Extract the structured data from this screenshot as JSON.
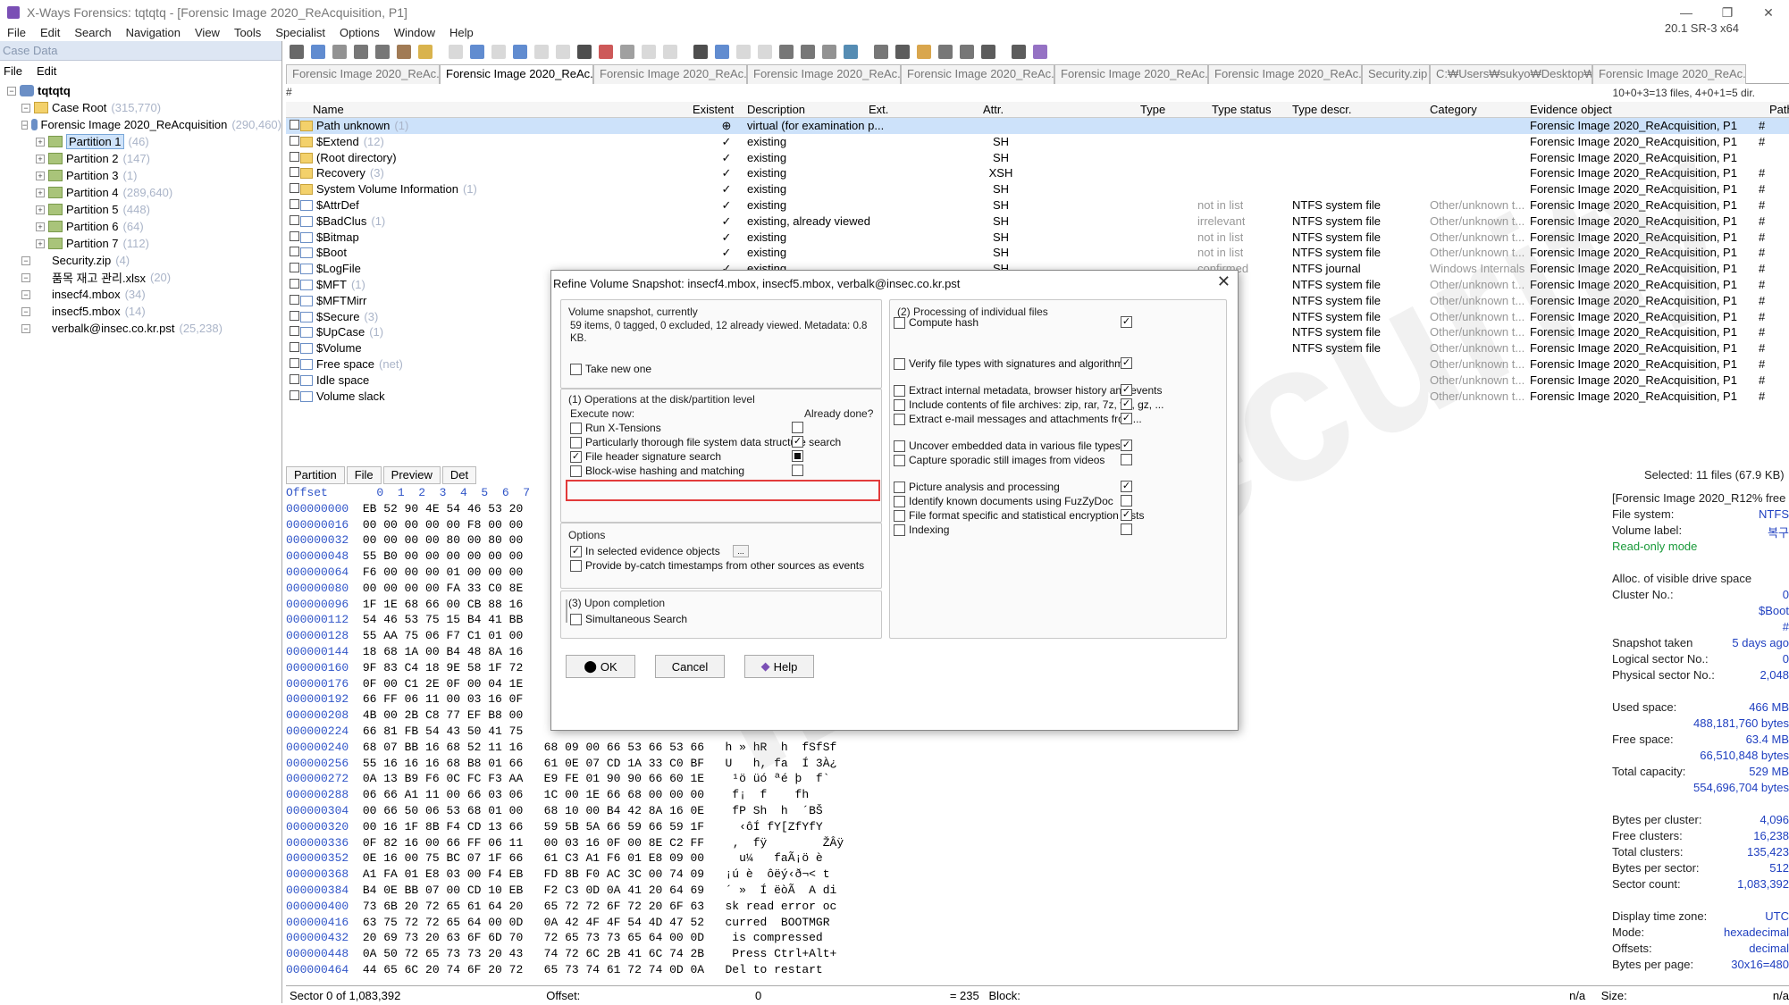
{
  "window": {
    "title": "X-Ways Forensics: tqtqtq - [Forensic Image 2020_ReAcquisition, P1]",
    "version": "20.1 SR-3 x64"
  },
  "menu": [
    "File",
    "Edit",
    "Search",
    "Navigation",
    "View",
    "Tools",
    "Specialist",
    "Options",
    "Window",
    "Help"
  ],
  "case": {
    "header": "Case Data",
    "menu": [
      "File",
      "Edit"
    ],
    "tree": [
      {
        "label": "tqtqtq",
        "count": "",
        "lvl": 0,
        "icon": "disk"
      },
      {
        "label": "Case Root",
        "count": "(315,770)",
        "lvl": 1,
        "icon": "fold"
      },
      {
        "label": "Forensic Image 2020_ReAcquisition",
        "count": "(290,460)",
        "lvl": 1,
        "icon": "disk"
      },
      {
        "label": "Partition 1",
        "count": "(46)",
        "lvl": 2,
        "icon": "part",
        "sel": true
      },
      {
        "label": "Partition 2",
        "count": "(147)",
        "lvl": 2,
        "icon": "part"
      },
      {
        "label": "Partition 3",
        "count": "(1)",
        "lvl": 2,
        "icon": "part"
      },
      {
        "label": "Partition 4",
        "count": "(289,640)",
        "lvl": 2,
        "icon": "part"
      },
      {
        "label": "Partition 5",
        "count": "(448)",
        "lvl": 2,
        "icon": "part"
      },
      {
        "label": "Partition 6",
        "count": "(64)",
        "lvl": 2,
        "icon": "part"
      },
      {
        "label": "Partition 7",
        "count": "(112)",
        "lvl": 2,
        "icon": "part"
      },
      {
        "label": "Security.zip",
        "count": "(4)",
        "lvl": 1,
        "icon": "file"
      },
      {
        "label": "품목 재고 관리.xlsx",
        "count": "(20)",
        "lvl": 1,
        "icon": "file"
      },
      {
        "label": "insecf4.mbox",
        "count": "(34)",
        "lvl": 1,
        "icon": "file"
      },
      {
        "label": "insecf5.mbox",
        "count": "(14)",
        "lvl": 1,
        "icon": "file"
      },
      {
        "label": "verbalk@insec.co.kr.pst",
        "count": "(25,238)",
        "lvl": 1,
        "icon": "file"
      }
    ]
  },
  "tabs": [
    "Forensic Image 2020_ReAc...",
    "Forensic Image 2020_ReAc...",
    "Forensic Image 2020_ReAc...",
    "Forensic Image 2020_ReAc...",
    "Forensic Image 2020_ReAc...",
    "Forensic Image 2020_ReAc...",
    "Forensic Image 2020_ReAc...",
    "Security.zip",
    "C:₩Users₩sukyo₩Desktop₩품...",
    "Forensic Image 2020_ReAc..."
  ],
  "count_text": "10+0+3=13 files, 4+0+1=5 dir.",
  "columns": [
    "Name",
    "Existent",
    "Description",
    "Ext.",
    "Attr.",
    "Type",
    "Type status",
    "Type descr.",
    "Category",
    "Evidence object",
    "Path"
  ],
  "rows": [
    {
      "name": "Path unknown",
      "count": "(1)",
      "ex": "⊕",
      "desc": "virtual (for examination p...",
      "attr": "",
      "ts": "",
      "td": "",
      "cat": "",
      "ev": "Forensic Image 2020_ReAcquisition, P1",
      "path": "#",
      "sel": true
    },
    {
      "name": "$Extend",
      "count": "(12)",
      "ex": "✓",
      "desc": "existing",
      "attr": "SH",
      "ts": "",
      "td": "",
      "cat": "",
      "ev": "Forensic Image 2020_ReAcquisition, P1",
      "path": "#"
    },
    {
      "name": "(Root directory)",
      "count": "",
      "ex": "✓",
      "desc": "existing",
      "attr": "SH",
      "ts": "",
      "td": "",
      "cat": "",
      "ev": "Forensic Image 2020_ReAcquisition, P1",
      "path": ""
    },
    {
      "name": "Recovery",
      "count": "(3)",
      "ex": "✓",
      "desc": "existing",
      "attr": "XSH",
      "ts": "",
      "td": "",
      "cat": "",
      "ev": "Forensic Image 2020_ReAcquisition, P1",
      "path": "#"
    },
    {
      "name": "System Volume Information",
      "count": "(1)",
      "ex": "✓",
      "desc": "existing",
      "attr": "SH",
      "ts": "",
      "td": "",
      "cat": "",
      "ev": "Forensic Image 2020_ReAcquisition, P1",
      "path": "#"
    },
    {
      "name": "$AttrDef",
      "count": "",
      "ex": "✓",
      "desc": "existing",
      "attr": "SH",
      "ts": "not in list",
      "td": "NTFS system file",
      "cat": "Other/unknown t...",
      "ev": "Forensic Image 2020_ReAcquisition, P1",
      "path": "#"
    },
    {
      "name": "$BadClus",
      "count": "(1)",
      "ex": "✓",
      "desc": "existing, already viewed",
      "attr": "SH",
      "ts": "irrelevant",
      "td": "NTFS system file",
      "cat": "Other/unknown t...",
      "ev": "Forensic Image 2020_ReAcquisition, P1",
      "path": "#"
    },
    {
      "name": "$Bitmap",
      "count": "",
      "ex": "✓",
      "desc": "existing",
      "attr": "SH",
      "ts": "not in list",
      "td": "NTFS system file",
      "cat": "Other/unknown t...",
      "ev": "Forensic Image 2020_ReAcquisition, P1",
      "path": "#"
    },
    {
      "name": "$Boot",
      "count": "",
      "ex": "✓",
      "desc": "existing",
      "attr": "SH",
      "ts": "not in list",
      "td": "NTFS system file",
      "cat": "Other/unknown t...",
      "ev": "Forensic Image 2020_ReAcquisition, P1",
      "path": "#"
    },
    {
      "name": "$LogFile",
      "count": "",
      "ex": "✓",
      "desc": "existing",
      "attr": "SH",
      "ts": "confirmed",
      "td": "NTFS journal",
      "cat": "Windows Internals",
      "ev": "Forensic Image 2020_ReAcquisition, P1",
      "path": "#"
    },
    {
      "name": "$MFT",
      "count": "(1)",
      "ex": "",
      "desc": "",
      "attr": "",
      "ts": "ed",
      "td": "NTFS system file",
      "cat": "Other/unknown t...",
      "ev": "Forensic Image 2020_ReAcquisition, P1",
      "path": "#"
    },
    {
      "name": "$MFTMirr",
      "count": "",
      "ex": "",
      "desc": "",
      "attr": "",
      "ts": "ed",
      "td": "NTFS system file",
      "cat": "Other/unknown t...",
      "ev": "Forensic Image 2020_ReAcquisition, P1",
      "path": "#"
    },
    {
      "name": "$Secure",
      "count": "(3)",
      "ex": "",
      "desc": "",
      "attr": "",
      "ts": "t",
      "td": "NTFS system file",
      "cat": "Other/unknown t...",
      "ev": "Forensic Image 2020_ReAcquisition, P1",
      "path": "#"
    },
    {
      "name": "$UpCase",
      "count": "(1)",
      "ex": "",
      "desc": "",
      "attr": "",
      "ts": "t",
      "td": "NTFS system file",
      "cat": "Other/unknown t...",
      "ev": "Forensic Image 2020_ReAcquisition, P1",
      "path": "#"
    },
    {
      "name": "$Volume",
      "count": "",
      "ex": "",
      "desc": "",
      "attr": "",
      "ts": "t",
      "td": "NTFS system file",
      "cat": "Other/unknown t...",
      "ev": "Forensic Image 2020_ReAcquisition, P1",
      "path": "#"
    },
    {
      "name": "Free space",
      "count": "(net)",
      "ex": "",
      "desc": "",
      "attr": "",
      "ts": "ied",
      "td": "",
      "cat": "Other/unknown t...",
      "ev": "Forensic Image 2020_ReAcquisition, P1",
      "path": "#"
    },
    {
      "name": "Idle space",
      "count": "",
      "ex": "",
      "desc": "",
      "attr": "",
      "ts": "ied",
      "td": "",
      "cat": "Other/unknown t...",
      "ev": "Forensic Image 2020_ReAcquisition, P1",
      "path": "#"
    },
    {
      "name": "Volume slack",
      "count": "",
      "ex": "",
      "desc": "",
      "attr": "",
      "ts": "ied",
      "td": "",
      "cat": "Other/unknown t...",
      "ev": "Forensic Image 2020_ReAcquisition, P1",
      "path": "#"
    }
  ],
  "midtabs": [
    "Partition",
    "File",
    "Preview",
    "Det"
  ],
  "selected_info": "Selected: 11 files (67.9 KB)",
  "hex": {
    "header": "Offset       0  1  2  3  4  5  6  7",
    "rows": [
      [
        "000000000",
        "EB 52 90 4E 54 46 53 20",
        ""
      ],
      [
        "000000016",
        "00 00 00 00 00 F8 00 00",
        ""
      ],
      [
        "000000032",
        "00 00 00 00 80 00 80 00",
        ""
      ],
      [
        "000000048",
        "55 B0 00 00 00 00 00 00",
        ""
      ],
      [
        "000000064",
        "F6 00 00 00 01 00 00 00",
        ""
      ],
      [
        "000000080",
        "00 00 00 00 FA 33 C0 8E",
        ""
      ],
      [
        "000000096",
        "1F 1E 68 66 00 CB 88 16",
        ""
      ],
      [
        "000000112",
        "54 46 53 75 15 B4 41 BB",
        ""
      ],
      [
        "000000128",
        "55 AA 75 06 F7 C1 01 00",
        ""
      ],
      [
        "000000144",
        "18 68 1A 00 B4 48 8A 16",
        ""
      ],
      [
        "000000160",
        "9F 83 C4 18 9E 58 1F 72",
        ""
      ],
      [
        "000000176",
        "0F 00 C1 2E 0F 00 04 1E",
        ""
      ],
      [
        "000000192",
        "66 FF 06 11 00 03 16 0F",
        ""
      ],
      [
        "000000208",
        "4B 00 2B C8 77 EF B8 00",
        ""
      ],
      [
        "000000224",
        "66 81 FB 54 43 50 41 75",
        ""
      ],
      [
        "000000240",
        "68 07 BB 16 68 52 11 16",
        "68 09 00 66 53 66 53 66   h » hR  h  fSfSf"
      ],
      [
        "000000256",
        "55 16 16 16 68 B8 01 66",
        "61 0E 07 CD 1A 33 C0 BF   U   h, fa  Í 3À¿"
      ],
      [
        "000000272",
        "0A 13 B9 F6 0C FC F3 AA",
        "E9 FE 01 90 90 66 60 1E    ¹ö üó ªé þ  f`"
      ],
      [
        "000000288",
        "06 66 A1 11 00 66 03 06",
        "1C 00 1E 66 68 00 00 00    f¡  f    fh"
      ],
      [
        "000000304",
        "00 66 50 06 53 68 01 00",
        "68 10 00 B4 42 8A 16 0E    fP Sh  h  ´BŠ"
      ],
      [
        "000000320",
        "00 16 1F 8B F4 CD 13 66",
        "59 5B 5A 66 59 66 59 1F     ‹ôÍ fY[ZfYfY"
      ],
      [
        "000000336",
        "0F 82 16 00 66 FF 06 11",
        "00 03 16 0F 00 8E C2 FF    ‚  fÿ        ŽÂÿ"
      ],
      [
        "000000352",
        "0E 16 00 75 BC 07 1F 66",
        "61 C3 A1 F6 01 E8 09 00     u¼   faÃ¡ö è"
      ],
      [
        "000000368",
        "A1 FA 01 E8 03 00 F4 EB",
        "FD 8B F0 AC 3C 00 74 09   ¡ú è  ôëý‹ð¬< t"
      ],
      [
        "000000384",
        "B4 0E BB 07 00 CD 10 EB",
        "F2 C3 0D 0A 41 20 64 69   ´ »  Í ëòÃ  A di"
      ],
      [
        "000000400",
        "73 6B 20 72 65 61 64 20",
        "65 72 72 6F 72 20 6F 63   sk read error oc"
      ],
      [
        "000000416",
        "63 75 72 72 65 64 00 0D",
        "0A 42 4F 4F 54 4D 47 52   curred  BOOTMGR"
      ],
      [
        "000000432",
        "20 69 73 20 63 6F 6D 70",
        "72 65 73 73 65 64 00 0D    is compressed"
      ],
      [
        "000000448",
        "0A 50 72 65 73 73 20 43",
        "74 72 6C 2B 41 6C 74 2B    Press Ctrl+Alt+"
      ],
      [
        "000000464",
        "44 65 6C 20 74 6F 20 72",
        "65 73 74 61 72 74 0D 0A   Del to restart"
      ]
    ]
  },
  "info": {
    "title": "[Forensic Image 2020_R12% free",
    "rows": [
      [
        "File system:",
        "NTFS"
      ],
      [
        "Volume label:",
        "복구"
      ],
      [
        "Read-only mode",
        ""
      ],
      [
        "",
        ""
      ],
      [
        "Alloc. of visible drive space",
        ""
      ],
      [
        "Cluster No.:",
        "0"
      ],
      [
        "",
        "$Boot"
      ],
      [
        "",
        "#"
      ],
      [
        "Snapshot taken",
        "5 days ago"
      ],
      [
        "Logical sector No.:",
        "0"
      ],
      [
        "Physical sector No.:",
        "2,048"
      ],
      [
        "",
        ""
      ],
      [
        "Used space:",
        "466 MB"
      ],
      [
        "",
        "488,181,760 bytes"
      ],
      [
        "Free space:",
        "63.4 MB"
      ],
      [
        "",
        "66,510,848 bytes"
      ],
      [
        "Total capacity:",
        "529 MB"
      ],
      [
        "",
        "554,696,704 bytes"
      ],
      [
        "",
        ""
      ],
      [
        "Bytes per cluster:",
        "4,096"
      ],
      [
        "Free clusters:",
        "16,238"
      ],
      [
        "Total clusters:",
        "135,423"
      ],
      [
        "Bytes per sector:",
        "512"
      ],
      [
        "Sector count:",
        "1,083,392"
      ],
      [
        "",
        ""
      ],
      [
        "Display time zone:",
        "UTC"
      ],
      [
        "Mode:",
        "hexadecimal"
      ],
      [
        "Offsets:",
        "decimal"
      ],
      [
        "Bytes per page:",
        "30x16=480"
      ]
    ]
  },
  "status": {
    "sector": "Sector 0 of 1,083,392",
    "offset_label": "Offset:",
    "offset_val": "0",
    "eq": "= 235",
    "block": "Block:",
    "na": "n/a",
    "size": "Size:",
    "na2": "n/a"
  },
  "dialog": {
    "title": "Refine Volume Snapshot: insecf4.mbox, insecf5.mbox, verbalk@insec.co.kr.pst",
    "snap_label": "Volume snapshot, currently",
    "snap_text": "59 items, 0 tagged, 0 excluded, 12 already viewed. Metadata: 0.8 KB.",
    "take_new": "Take new one",
    "g1_label": "(1) Operations at the disk/partition level",
    "exec_now": "Execute now:",
    "already_done": "Already done?",
    "g1_items": [
      {
        "label": "Run X-Tensions",
        "on": false,
        "done": "empty"
      },
      {
        "label": "Particularly thorough file system data structure search",
        "on": false,
        "done": "on"
      },
      {
        "label": "File header signature search",
        "on": true,
        "done": "filled"
      },
      {
        "label": "Block-wise hashing and matching",
        "on": false,
        "done": "empty"
      }
    ],
    "options_label": "Options",
    "opt_items": [
      {
        "label": "In selected evidence objects",
        "on": true
      },
      {
        "label": "Provide by-catch timestamps from other sources as events",
        "on": false
      }
    ],
    "g3_label": "(3) Upon completion",
    "g3_items": [
      {
        "label": "Simultaneous Search",
        "on": false
      }
    ],
    "g2_label": "(2) Processing of individual files",
    "g2_items": [
      {
        "label": "Compute hash",
        "on": false,
        "done": "on"
      },
      {
        "label": "Verify file types with signatures and algorithms",
        "on": false,
        "done": "on"
      },
      {
        "label": "Extract internal metadata, browser history and events",
        "on": false,
        "done": "on"
      },
      {
        "label": "Include contents of file archives: zip, rar, 7z, tar, gz, ...",
        "on": false,
        "done": "on"
      },
      {
        "label": "Extract e-mail messages and attachments from...",
        "on": false,
        "done": "on"
      },
      {
        "label": "Uncover embedded data in various file types",
        "on": false,
        "done": "on"
      },
      {
        "label": "Capture sporadic still images from videos",
        "on": false,
        "done": "empty"
      },
      {
        "label": "Picture analysis and processing",
        "on": false,
        "done": "on"
      },
      {
        "label": "Identify known documents using FuzZyDoc",
        "on": false,
        "done": "empty"
      },
      {
        "label": "File format specific and statistical encryption tests",
        "on": false,
        "done": "on"
      },
      {
        "label": "Indexing",
        "on": false,
        "done": "empty"
      }
    ],
    "ok": "OK",
    "cancel": "Cancel",
    "help": "Help"
  },
  "watermark": "IES security",
  "colors": {
    "selection": "#cde2fa",
    "hex_offset": "#3055c8",
    "highlight": "#e23a3a",
    "info_value": "#2040c0"
  }
}
